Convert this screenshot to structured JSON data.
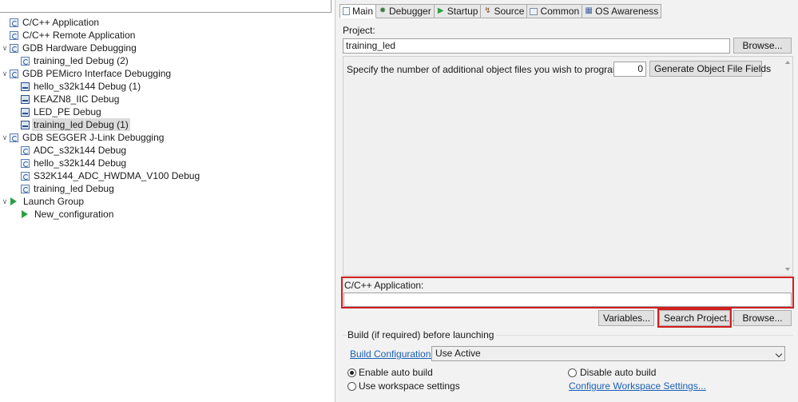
{
  "tree": {
    "filter_value": "",
    "items": [
      {
        "label": "C/C++ Application"
      },
      {
        "label": "C/C++ Remote Application"
      },
      {
        "label": "GDB Hardware Debugging"
      },
      {
        "label": "training_led Debug (2)"
      },
      {
        "label": "GDB PEMicro Interface Debugging"
      },
      {
        "label": "hello_s32k144 Debug (1)"
      },
      {
        "label": "KEAZN8_IIC Debug"
      },
      {
        "label": "LED_PE Debug"
      },
      {
        "label": "training_led Debug (1)"
      },
      {
        "label": "GDB SEGGER J-Link Debugging"
      },
      {
        "label": "ADC_s32k144 Debug"
      },
      {
        "label": "hello_s32k144 Debug"
      },
      {
        "label": "S32K144_ADC_HWDMA_V100 Debug"
      },
      {
        "label": "training_led Debug"
      },
      {
        "label": "Launch Group"
      },
      {
        "label": "New_configuration"
      }
    ]
  },
  "tabs": [
    {
      "label": "Main",
      "icon": "main-tab-icon"
    },
    {
      "label": "Debugger",
      "icon": "bug-icon"
    },
    {
      "label": "Startup",
      "icon": "startup-play-icon"
    },
    {
      "label": "Source",
      "icon": "source-icon"
    },
    {
      "label": "Common",
      "icon": "common-icon"
    },
    {
      "label": "OS Awareness",
      "icon": "os-awareness-icon"
    }
  ],
  "main": {
    "project_label": "Project:",
    "project_value": "training_led",
    "browse_label": "Browse...",
    "object_files_prompt": "Specify the number of additional object files you wish to program:",
    "object_files_count": "0",
    "generate_button": "Generate Object File Fields",
    "app_label": "C/C++ Application:",
    "app_value": "",
    "variables_button": "Variables...",
    "search_project_button": "Search Project...",
    "browse2_button": "Browse...",
    "build_header": "Build (if required) before launching",
    "build_config_link": "Build Configuration:",
    "build_config_value": "Use Active",
    "enable_auto_build": "Enable auto build",
    "disable_auto_build": "Disable auto build",
    "use_workspace_settings": "Use workspace settings",
    "configure_workspace_link": "Configure Workspace Settings..."
  },
  "colors": {
    "highlight_red": "#d01f1f",
    "link_blue": "#1a5fb4",
    "launch_green": "#2aa043"
  }
}
